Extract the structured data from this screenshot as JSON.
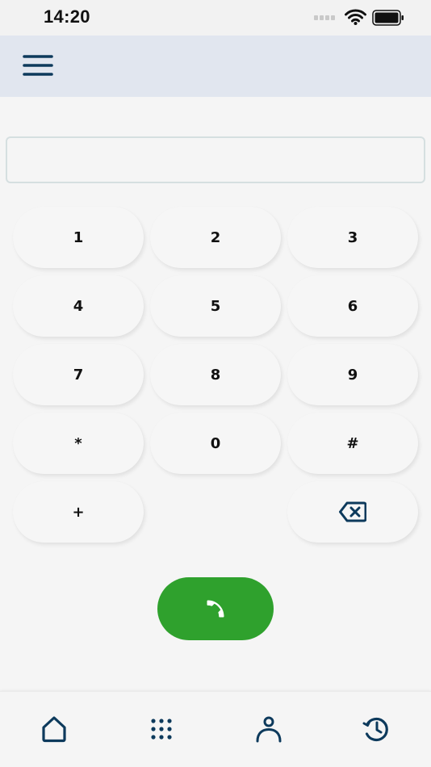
{
  "status_bar": {
    "time": "14:20",
    "icons": [
      "signal-icon",
      "wifi-icon",
      "battery-icon"
    ]
  },
  "header": {
    "menu_icon": "hamburger-menu-icon"
  },
  "dialer": {
    "number_value": "",
    "number_placeholder": ""
  },
  "keypad": {
    "keys": [
      {
        "label": "1"
      },
      {
        "label": "2"
      },
      {
        "label": "3"
      },
      {
        "label": "4"
      },
      {
        "label": "5"
      },
      {
        "label": "6"
      },
      {
        "label": "7"
      },
      {
        "label": "8"
      },
      {
        "label": "9"
      },
      {
        "label": "*"
      },
      {
        "label": "0"
      },
      {
        "label": "#"
      },
      {
        "label": "+"
      }
    ],
    "backspace_icon": "backspace-icon"
  },
  "call": {
    "icon": "phone-icon",
    "color": "#2fa12d"
  },
  "bottom_nav": {
    "items": [
      {
        "icon": "home-icon"
      },
      {
        "icon": "dialpad-icon"
      },
      {
        "icon": "contacts-icon"
      },
      {
        "icon": "history-icon"
      }
    ]
  },
  "colors": {
    "accent": "#0d3a5c",
    "header_background": "#e1e6ef",
    "background": "#f5f5f5"
  }
}
